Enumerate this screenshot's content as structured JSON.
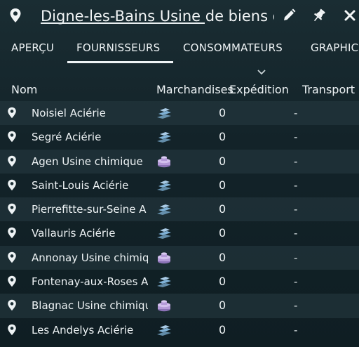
{
  "window": {
    "title": "Digne-les-Bains Usine de biens de co",
    "buttons": [
      "edit-icon",
      "pin-icon",
      "close-icon"
    ]
  },
  "tabs": [
    {
      "label": "APERÇU",
      "active": false
    },
    {
      "label": "FOURNISSEURS",
      "active": true
    },
    {
      "label": "CONSOMMATEURS",
      "active": false
    },
    {
      "label": "GRAPHIC",
      "active": false
    }
  ],
  "table": {
    "headers": [
      "Nom",
      "Marchandises",
      "Expédition",
      "Transport"
    ],
    "rows": [
      {
        "name": "Noisiel Aciérie",
        "goods_icon": "steel-icon",
        "qty": "0",
        "shipping": "-"
      },
      {
        "name": "Segré Aciérie",
        "goods_icon": "steel-icon",
        "qty": "0",
        "shipping": "-"
      },
      {
        "name": "Agen Usine chimique",
        "goods_icon": "chemicals-icon",
        "qty": "0",
        "shipping": "-"
      },
      {
        "name": "Saint-Louis Aciérie",
        "goods_icon": "steel-icon",
        "qty": "0",
        "shipping": "-"
      },
      {
        "name": "Pierrefitte-sur-Seine A",
        "goods_icon": "steel-icon",
        "qty": "0",
        "shipping": "-"
      },
      {
        "name": "Vallauris Aciérie",
        "goods_icon": "steel-icon",
        "qty": "0",
        "shipping": "-"
      },
      {
        "name": "Annonay Usine chimiq",
        "goods_icon": "chemicals-icon",
        "qty": "0",
        "shipping": "-"
      },
      {
        "name": "Fontenay-aux-Roses A",
        "goods_icon": "steel-icon",
        "qty": "0",
        "shipping": "-"
      },
      {
        "name": "Blagnac Usine chimiqu",
        "goods_icon": "chemicals-icon",
        "qty": "0",
        "shipping": "-"
      },
      {
        "name": "Les Andelys Aciérie",
        "goods_icon": "steel-icon",
        "qty": "0",
        "shipping": "-"
      }
    ]
  },
  "colors": {
    "steel": "#7fb1d6",
    "chemicals": "#b49ad8",
    "text": "#eef3f5"
  }
}
